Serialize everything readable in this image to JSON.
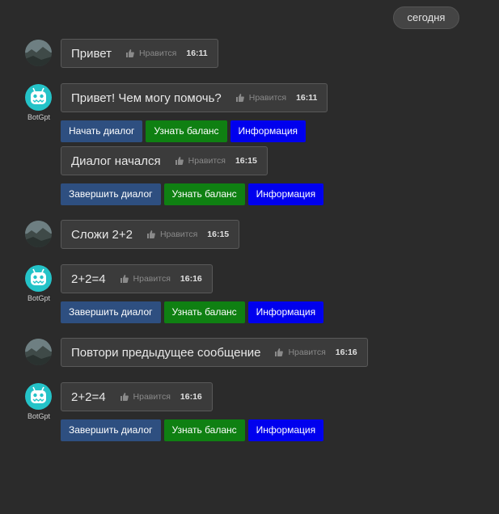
{
  "date_label": "сегодня",
  "bot_name": "BotGpt",
  "like_label": "Нравится",
  "colors": {
    "background": "#2b2b2b",
    "bubble": "#3b3b3b",
    "button_primary": "#2e4f80",
    "button_success": "#0f8012",
    "button_info": "#0000ee",
    "bot_avatar": "#24c3c8"
  },
  "messages": [
    {
      "sender": "user",
      "text": "Привет",
      "time": "16:11"
    },
    {
      "sender": "bot",
      "text": "Привет! Чем могу помочь?",
      "time": "16:11",
      "buttons": [
        "Начать диалог",
        "Узнать баланс",
        "Информация"
      ]
    },
    {
      "sender": "bot",
      "text": "Диалог начался",
      "time": "16:15",
      "buttons": [
        "Завершить диалог",
        "Узнать баланс",
        "Информация"
      ]
    },
    {
      "sender": "user",
      "text": "Сложи 2+2",
      "time": "16:15"
    },
    {
      "sender": "bot",
      "text": "2+2=4",
      "time": "16:16",
      "buttons": [
        "Завершить диалог",
        "Узнать баланс",
        "Информация"
      ]
    },
    {
      "sender": "user",
      "text": "Повтори предыдущее сообщение",
      "time": "16:16"
    },
    {
      "sender": "bot",
      "text": "2+2=4",
      "time": "16:16",
      "buttons": [
        "Завершить диалог",
        "Узнать баланс",
        "Информация"
      ]
    }
  ]
}
